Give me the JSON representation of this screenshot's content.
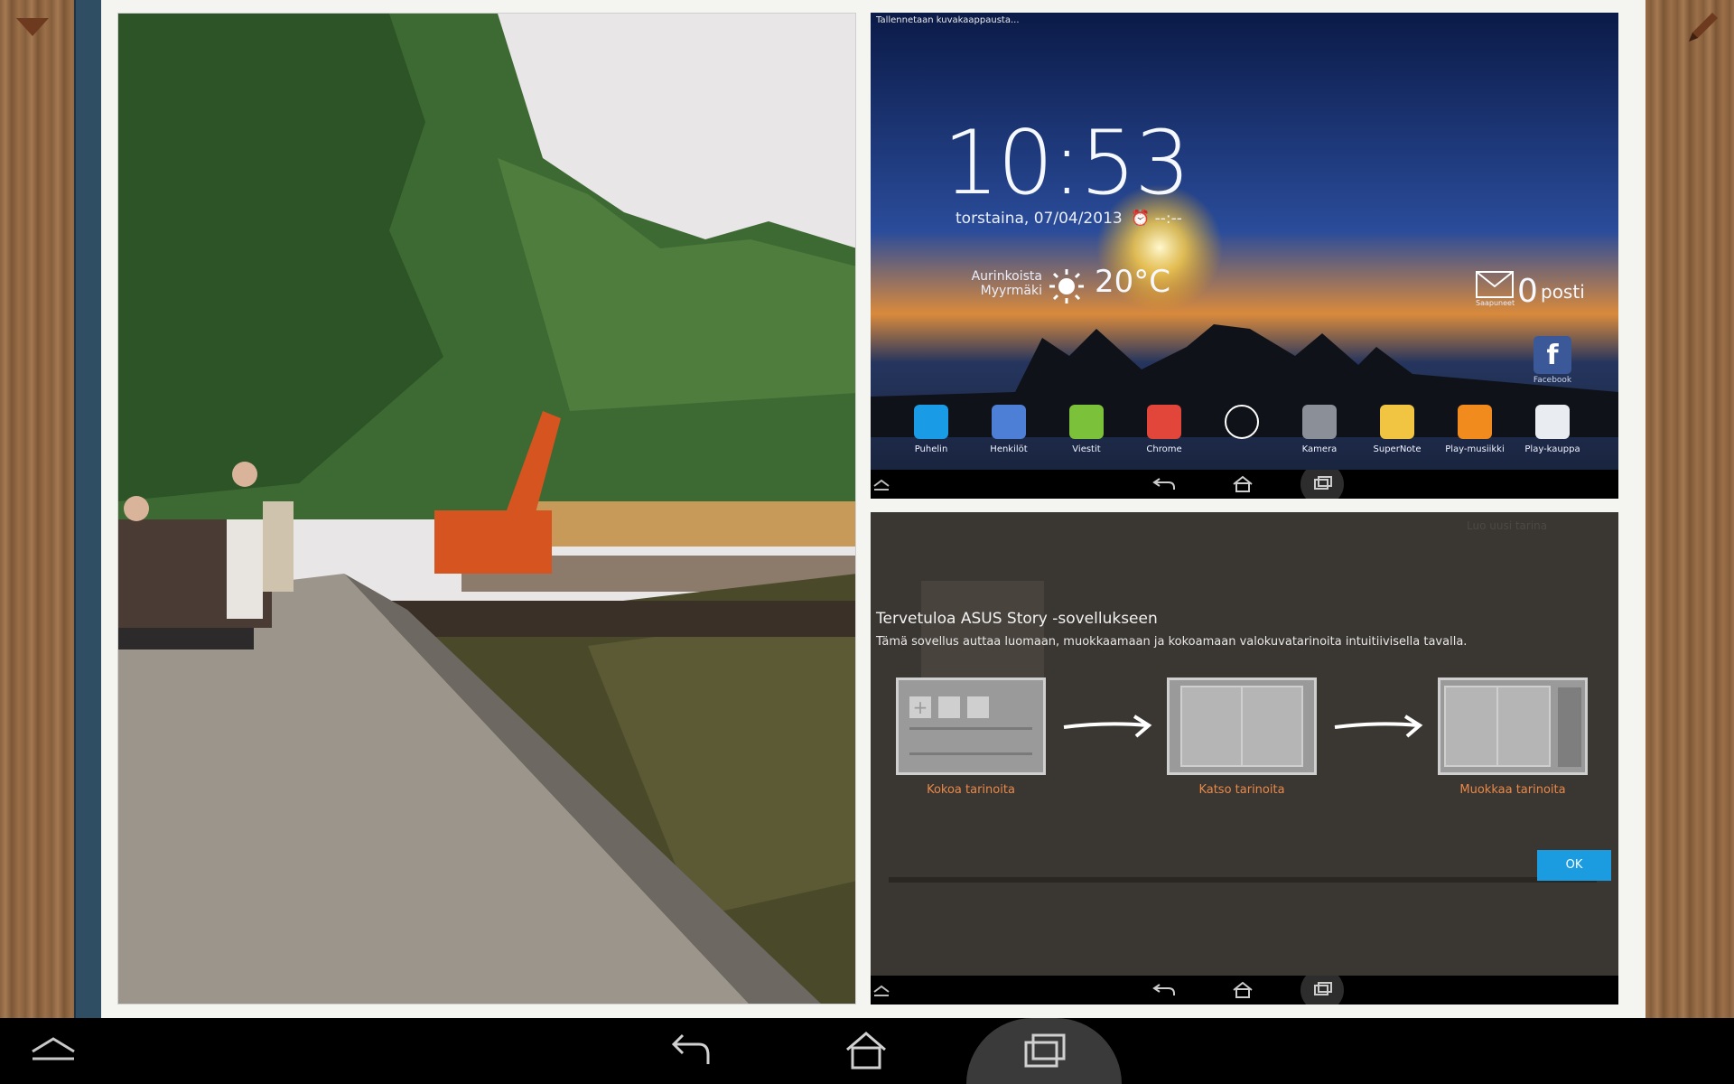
{
  "home_screen": {
    "status_text": "Tallennetaan kuvakaappausta...",
    "clock": "10:53",
    "date": "torstaina, 07/04/2013",
    "alarm": "--:--",
    "weather_condition": "Aurinkoista",
    "weather_location": "Myyrmäki",
    "temperature": "20°C",
    "mail_count": "0",
    "mail_label": "posti",
    "mail_sub": "Saapuneet",
    "facebook_label": "Facebook",
    "dock": [
      {
        "label": "Puhelin",
        "icon": "phone-icon",
        "color": "#1a9be6"
      },
      {
        "label": "Henkilöt",
        "icon": "contacts-icon",
        "color": "#4d7fd6"
      },
      {
        "label": "Viestit",
        "icon": "messages-icon",
        "color": "#7bc23a"
      },
      {
        "label": "Chrome",
        "icon": "chrome-icon",
        "color": "#e2463a"
      },
      {
        "label": "",
        "icon": "app-drawer-icon",
        "color": "#6d7a96"
      },
      {
        "label": "Kamera",
        "icon": "camera-icon",
        "color": "#8b8f98"
      },
      {
        "label": "SuperNote",
        "icon": "supernote-icon",
        "color": "#f1c442"
      },
      {
        "label": "Play-musiikki",
        "icon": "play-music-icon",
        "color": "#f28b1d"
      },
      {
        "label": "Play-kauppa",
        "icon": "play-store-icon",
        "color": "#e9edf2"
      }
    ]
  },
  "story_screen": {
    "ghost_text": "Luo uusi tarina",
    "title": "Tervetuloa ASUS Story -sovellukseen",
    "subtitle": "Tämä sovellus auttaa luomaan, muokkaamaan ja kokoamaan valokuvatarinoita intuitiivisella tavalla.",
    "steps": [
      "Kokoa tarinoita",
      "Katso tarinoita",
      "Muokkaa tarinoita"
    ],
    "ok_label": "OK"
  }
}
